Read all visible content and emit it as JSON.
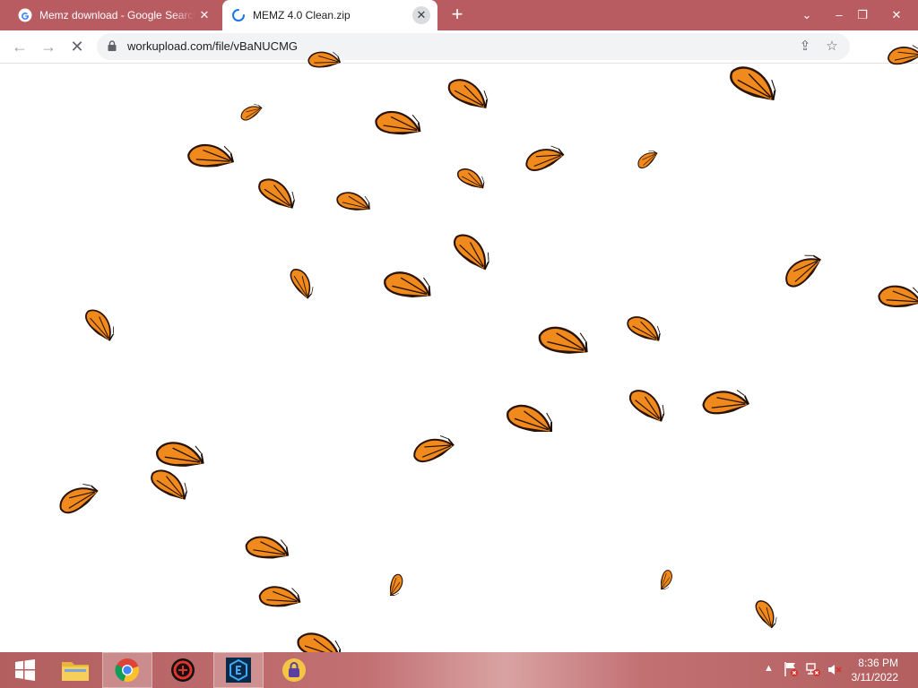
{
  "browser": {
    "tabs": [
      {
        "title": "Memz download - Google Search",
        "favicon": "google-g-icon",
        "state": "inactive"
      },
      {
        "title": "MEMZ 4.0 Clean.zip",
        "favicon": "loading-spinner-icon",
        "state": "active"
      }
    ],
    "new_tab_icon": "plus-icon",
    "window_controls": [
      "chevron-down-icon",
      "minimize-icon",
      "restore-icon",
      "close-icon"
    ],
    "nav": {
      "back_icon": "arrow-left-icon",
      "forward_icon": "arrow-right-icon",
      "stop_icon": "stop-x-icon"
    },
    "address": {
      "url": "workupload.com/file/vBaNUCMG",
      "secure_icon": "lock-icon"
    },
    "omnibox_actions": [
      "share-icon",
      "star-icon"
    ]
  },
  "taskbar": {
    "items": [
      "windows-start-icon",
      "file-explorer-icon",
      "chrome-icon",
      "app-red-icon",
      "app-blue-icon",
      "app-lock-icon"
    ],
    "tray_icons": [
      "chevron-up-icon",
      "action-center-flag-icon",
      "network-icon",
      "volume-muted-icon"
    ],
    "time": "8:36 PM",
    "date": "3/11/2022"
  },
  "colors": {
    "tab_strip": "#b85c62",
    "butterfly_orange": "#f08a1c",
    "butterfly_vein": "#2a1205"
  }
}
